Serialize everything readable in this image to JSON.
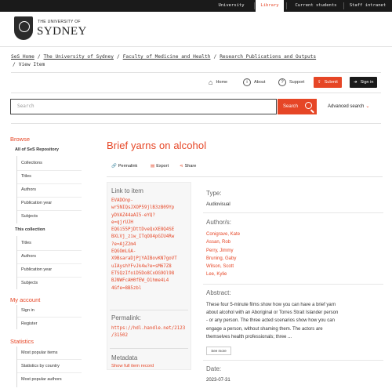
{
  "topbar": {
    "items": [
      {
        "label": "University",
        "active": false
      },
      {
        "label": "Library",
        "active": true
      },
      {
        "label": "Current students",
        "active": false
      },
      {
        "label": "Staff intranet",
        "active": false
      }
    ]
  },
  "logo": {
    "line1": "THE UNIVERSITY OF",
    "line2": "SYDNEY"
  },
  "breadcrumb": {
    "links": [
      "SeS Home",
      "The University of Sydney",
      "Faculty of Medicine and Health",
      "Research Publications and Outputs"
    ],
    "separator": "/",
    "current": "View Item"
  },
  "actions": {
    "home": "Home",
    "about": "About",
    "support": "Support",
    "submit": "Submit",
    "signin": "Sign in"
  },
  "search": {
    "placeholder": "Search",
    "button": "Search",
    "advanced": "Advanced search"
  },
  "sidebar": {
    "browse": "Browse",
    "all_repo": "All of SeS Repository",
    "all_items": [
      "Collections",
      "Titles",
      "Authors",
      "Publication year",
      "Subjects"
    ],
    "this_collection": "This collection",
    "coll_items": [
      "Titles",
      "Authors",
      "Publication year",
      "Subjects"
    ],
    "my_account": "My account",
    "account_items": [
      "Sign in",
      "Register"
    ],
    "statistics": "Statistics",
    "stats_items": [
      "Most popular items",
      "Statistics by country",
      "Most popular authors"
    ]
  },
  "item": {
    "title": "Brief yarns on alcohol",
    "tools": {
      "permalink": "Permalink",
      "export": "Export",
      "share": "Share"
    },
    "link_heading": "Link to item",
    "link_lines": [
      "EVADOnp-",
      "wr5NIQsJXOP59jlB3zB09Yp",
      "yDVAZ44aAI5-eYQ?",
      "e=qjrUJH",
      "EQGi55PjDttDveQxXE8Q4SE",
      "BXLVj_ziw_ITqOO4pGIU4Rw",
      "?e=AjZ2m4",
      "EQGOmLGA-",
      "X9BsaraDjPjYAIBovKN7goVT",
      "uIAyshYFvJk4w?e=sM67Z8",
      "ETSQzIfoiD5Do8CxOG9Ol98",
      "BJNWFcAH0fEW_O1hme4L4",
      "4Gfe=8B5zbl"
    ],
    "permalink_heading": "Permalink:",
    "permalink_lines": [
      "https://hdl.handle.net/2123",
      "/31502"
    ],
    "metadata_heading": "Metadata",
    "metadata_link": "Show full item record",
    "type_heading": "Type:",
    "type_value": "Audiovisual",
    "authors_heading": "Author/s:",
    "authors": [
      "Conigrave, Kate",
      "Assan, Rob",
      "Perry, Jimmy",
      "Bruning, Gaby",
      "Wilson, Scott",
      "Lee, Kylie"
    ],
    "abstract_heading": "Abstract:",
    "abstract_lines": [
      "These four 5-minute films show how you can have a brief yarn",
      "about alcohol with an Aboriginal or Torres Strait Islander person",
      "- or any person. The three acted scenarios show how you can",
      "engage a person, without shaming them. The actors are",
      "themselves health professionals; three ..."
    ],
    "see_more": "See more",
    "date_heading": "Date:",
    "date_value": "2023-07-31"
  },
  "colors": {
    "accent": "#e64626",
    "topbar": "#1a1a1a"
  }
}
